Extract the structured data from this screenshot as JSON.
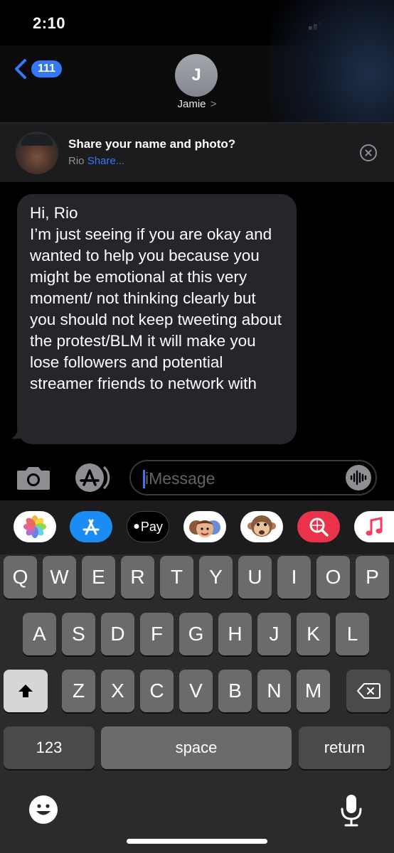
{
  "status_bar": {
    "time": "2:10"
  },
  "header": {
    "back_count": "111",
    "avatar_initial": "J",
    "contact_name": "Jamie",
    "contact_chevron": ">"
  },
  "share_banner": {
    "title": "Share your name and photo?",
    "name": "Rio",
    "share_link": "Share..."
  },
  "message": {
    "text": "Hi, Rio\nI’m just seeing if you are okay and wanted to help you because you might be emotional at this very moment/ not thinking clearly but you should not keep tweeting about the protest/BLM it will make you lose followers and potential streamer friends to network with"
  },
  "compose": {
    "placeholder": "iMessage"
  },
  "app_strip": {
    "items": [
      {
        "name": "photos",
        "label": ""
      },
      {
        "name": "app-store",
        "label": ""
      },
      {
        "name": "apple-pay",
        "label": "Pay"
      },
      {
        "name": "memoji",
        "label": ""
      },
      {
        "name": "animoji",
        "label": ""
      },
      {
        "name": "web-search",
        "label": ""
      },
      {
        "name": "music",
        "label": ""
      }
    ]
  },
  "keyboard": {
    "row1": [
      "Q",
      "W",
      "E",
      "R",
      "T",
      "Y",
      "U",
      "I",
      "O",
      "P"
    ],
    "row2": [
      "A",
      "S",
      "D",
      "F",
      "G",
      "H",
      "J",
      "K",
      "L"
    ],
    "row3": [
      "Z",
      "X",
      "C",
      "V",
      "B",
      "N",
      "M"
    ],
    "numbers_label": "123",
    "space_label": "space",
    "return_label": "return"
  },
  "colors": {
    "accent": "#3478f6",
    "bubble": "#26262a",
    "keyboard_bg": "#2b2b2d",
    "key": "#6b6b6e"
  }
}
